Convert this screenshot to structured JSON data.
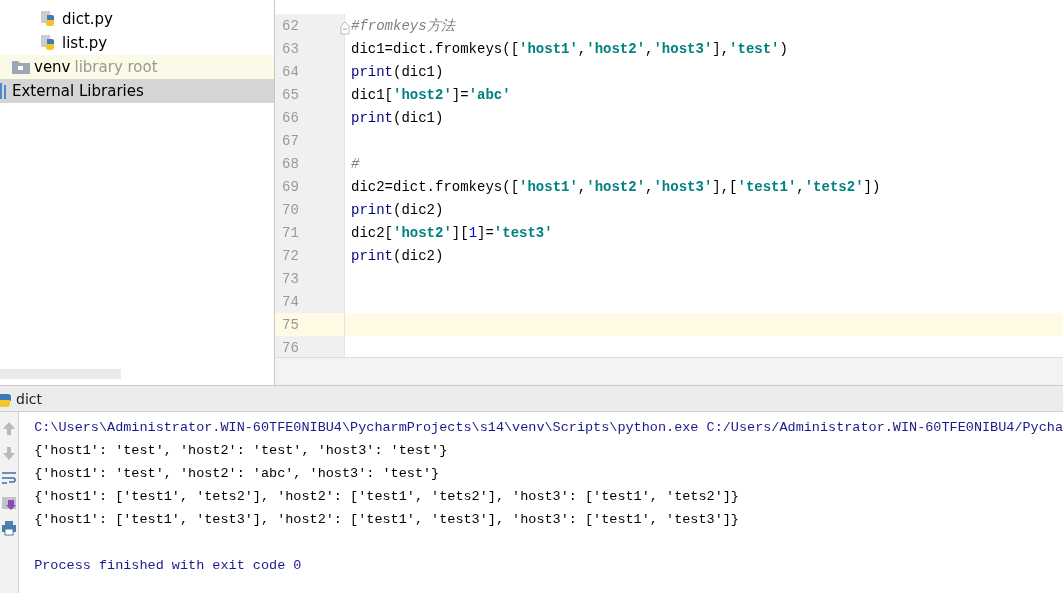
{
  "project_tree": {
    "items": [
      {
        "label": "dict.py",
        "kind": "python-file",
        "selected": false
      },
      {
        "label": "list.py",
        "kind": "python-file",
        "selected": false
      },
      {
        "label": "venv",
        "kind": "folder",
        "note": "library root",
        "selected": false
      },
      {
        "label": "External Libraries",
        "kind": "library",
        "selected": true
      }
    ]
  },
  "editor": {
    "lines": [
      {
        "number": "62",
        "current": false,
        "fold": true,
        "tokens": [
          {
            "text": "#fromkeys方法",
            "kind": "comment"
          }
        ]
      },
      {
        "number": "63",
        "current": false,
        "tokens": [
          {
            "text": "dic1=dict.fromkeys([",
            "kind": "plain"
          },
          {
            "text": "'host1'",
            "kind": "string"
          },
          {
            "text": ",",
            "kind": "plain"
          },
          {
            "text": "'host2'",
            "kind": "string"
          },
          {
            "text": ",",
            "kind": "plain"
          },
          {
            "text": "'host3'",
            "kind": "string"
          },
          {
            "text": "],",
            "kind": "plain"
          },
          {
            "text": "'test'",
            "kind": "string"
          },
          {
            "text": ")",
            "kind": "plain"
          }
        ]
      },
      {
        "number": "64",
        "current": false,
        "tokens": [
          {
            "text": "print",
            "kind": "builtin"
          },
          {
            "text": "(dic1)",
            "kind": "plain"
          }
        ]
      },
      {
        "number": "65",
        "current": false,
        "tokens": [
          {
            "text": "dic1[",
            "kind": "plain"
          },
          {
            "text": "'host2'",
            "kind": "string"
          },
          {
            "text": "]=",
            "kind": "plain"
          },
          {
            "text": "'abc'",
            "kind": "string"
          }
        ]
      },
      {
        "number": "66",
        "current": false,
        "tokens": [
          {
            "text": "print",
            "kind": "builtin"
          },
          {
            "text": "(dic1)",
            "kind": "plain"
          }
        ]
      },
      {
        "number": "67",
        "current": false
      },
      {
        "number": "68",
        "current": false,
        "tokens": [
          {
            "text": "#",
            "kind": "comment"
          }
        ]
      },
      {
        "number": "69",
        "current": false,
        "tokens": [
          {
            "text": "dic2=dict.fromkeys([",
            "kind": "plain"
          },
          {
            "text": "'host1'",
            "kind": "string"
          },
          {
            "text": ",",
            "kind": "plain"
          },
          {
            "text": "'host2'",
            "kind": "string"
          },
          {
            "text": ",",
            "kind": "plain"
          },
          {
            "text": "'host3'",
            "kind": "string"
          },
          {
            "text": "],[",
            "kind": "plain"
          },
          {
            "text": "'test1'",
            "kind": "string"
          },
          {
            "text": ",",
            "kind": "plain"
          },
          {
            "text": "'tets2'",
            "kind": "string"
          },
          {
            "text": "])",
            "kind": "plain"
          }
        ]
      },
      {
        "number": "70",
        "current": false,
        "tokens": [
          {
            "text": "print",
            "kind": "builtin"
          },
          {
            "text": "(dic2)",
            "kind": "plain"
          }
        ]
      },
      {
        "number": "71",
        "current": false,
        "tokens": [
          {
            "text": "dic2[",
            "kind": "plain"
          },
          {
            "text": "'host2'",
            "kind": "string"
          },
          {
            "text": "][",
            "kind": "plain"
          },
          {
            "text": "1",
            "kind": "number"
          },
          {
            "text": "]=",
            "kind": "plain"
          },
          {
            "text": "'test3'",
            "kind": "string"
          }
        ]
      },
      {
        "number": "72",
        "current": false,
        "tokens": [
          {
            "text": "print",
            "kind": "builtin"
          },
          {
            "text": "(dic2)",
            "kind": "plain"
          }
        ]
      },
      {
        "number": "73",
        "current": false
      },
      {
        "number": "74",
        "current": false
      },
      {
        "number": "75",
        "current": true
      },
      {
        "number": "76",
        "current": false
      }
    ]
  },
  "run_panel": {
    "title": "dict",
    "output": [
      {
        "text": "C:\\Users\\Administrator.WIN-60TFE0NIBU4\\PycharmProjects\\s14\\venv\\Scripts\\python.exe C:/Users/Administrator.WIN-60TFE0NIBU4/Pycha",
        "kind": "command"
      },
      {
        "text": "{'host1': 'test', 'host2': 'test', 'host3': 'test'}",
        "kind": "stdout"
      },
      {
        "text": "{'host1': 'test', 'host2': 'abc', 'host3': 'test'}",
        "kind": "stdout"
      },
      {
        "text": "{'host1': ['test1', 'tets2'], 'host2': ['test1', 'tets2'], 'host3': ['test1', 'tets2']}",
        "kind": "stdout"
      },
      {
        "text": "{'host1': ['test1', 'test3'], 'host2': ['test1', 'test3'], 'host3': ['test1', 'test3']}",
        "kind": "stdout"
      },
      {
        "kind": "blank"
      },
      {
        "text": "Process finished with exit code 0",
        "kind": "system"
      }
    ]
  }
}
